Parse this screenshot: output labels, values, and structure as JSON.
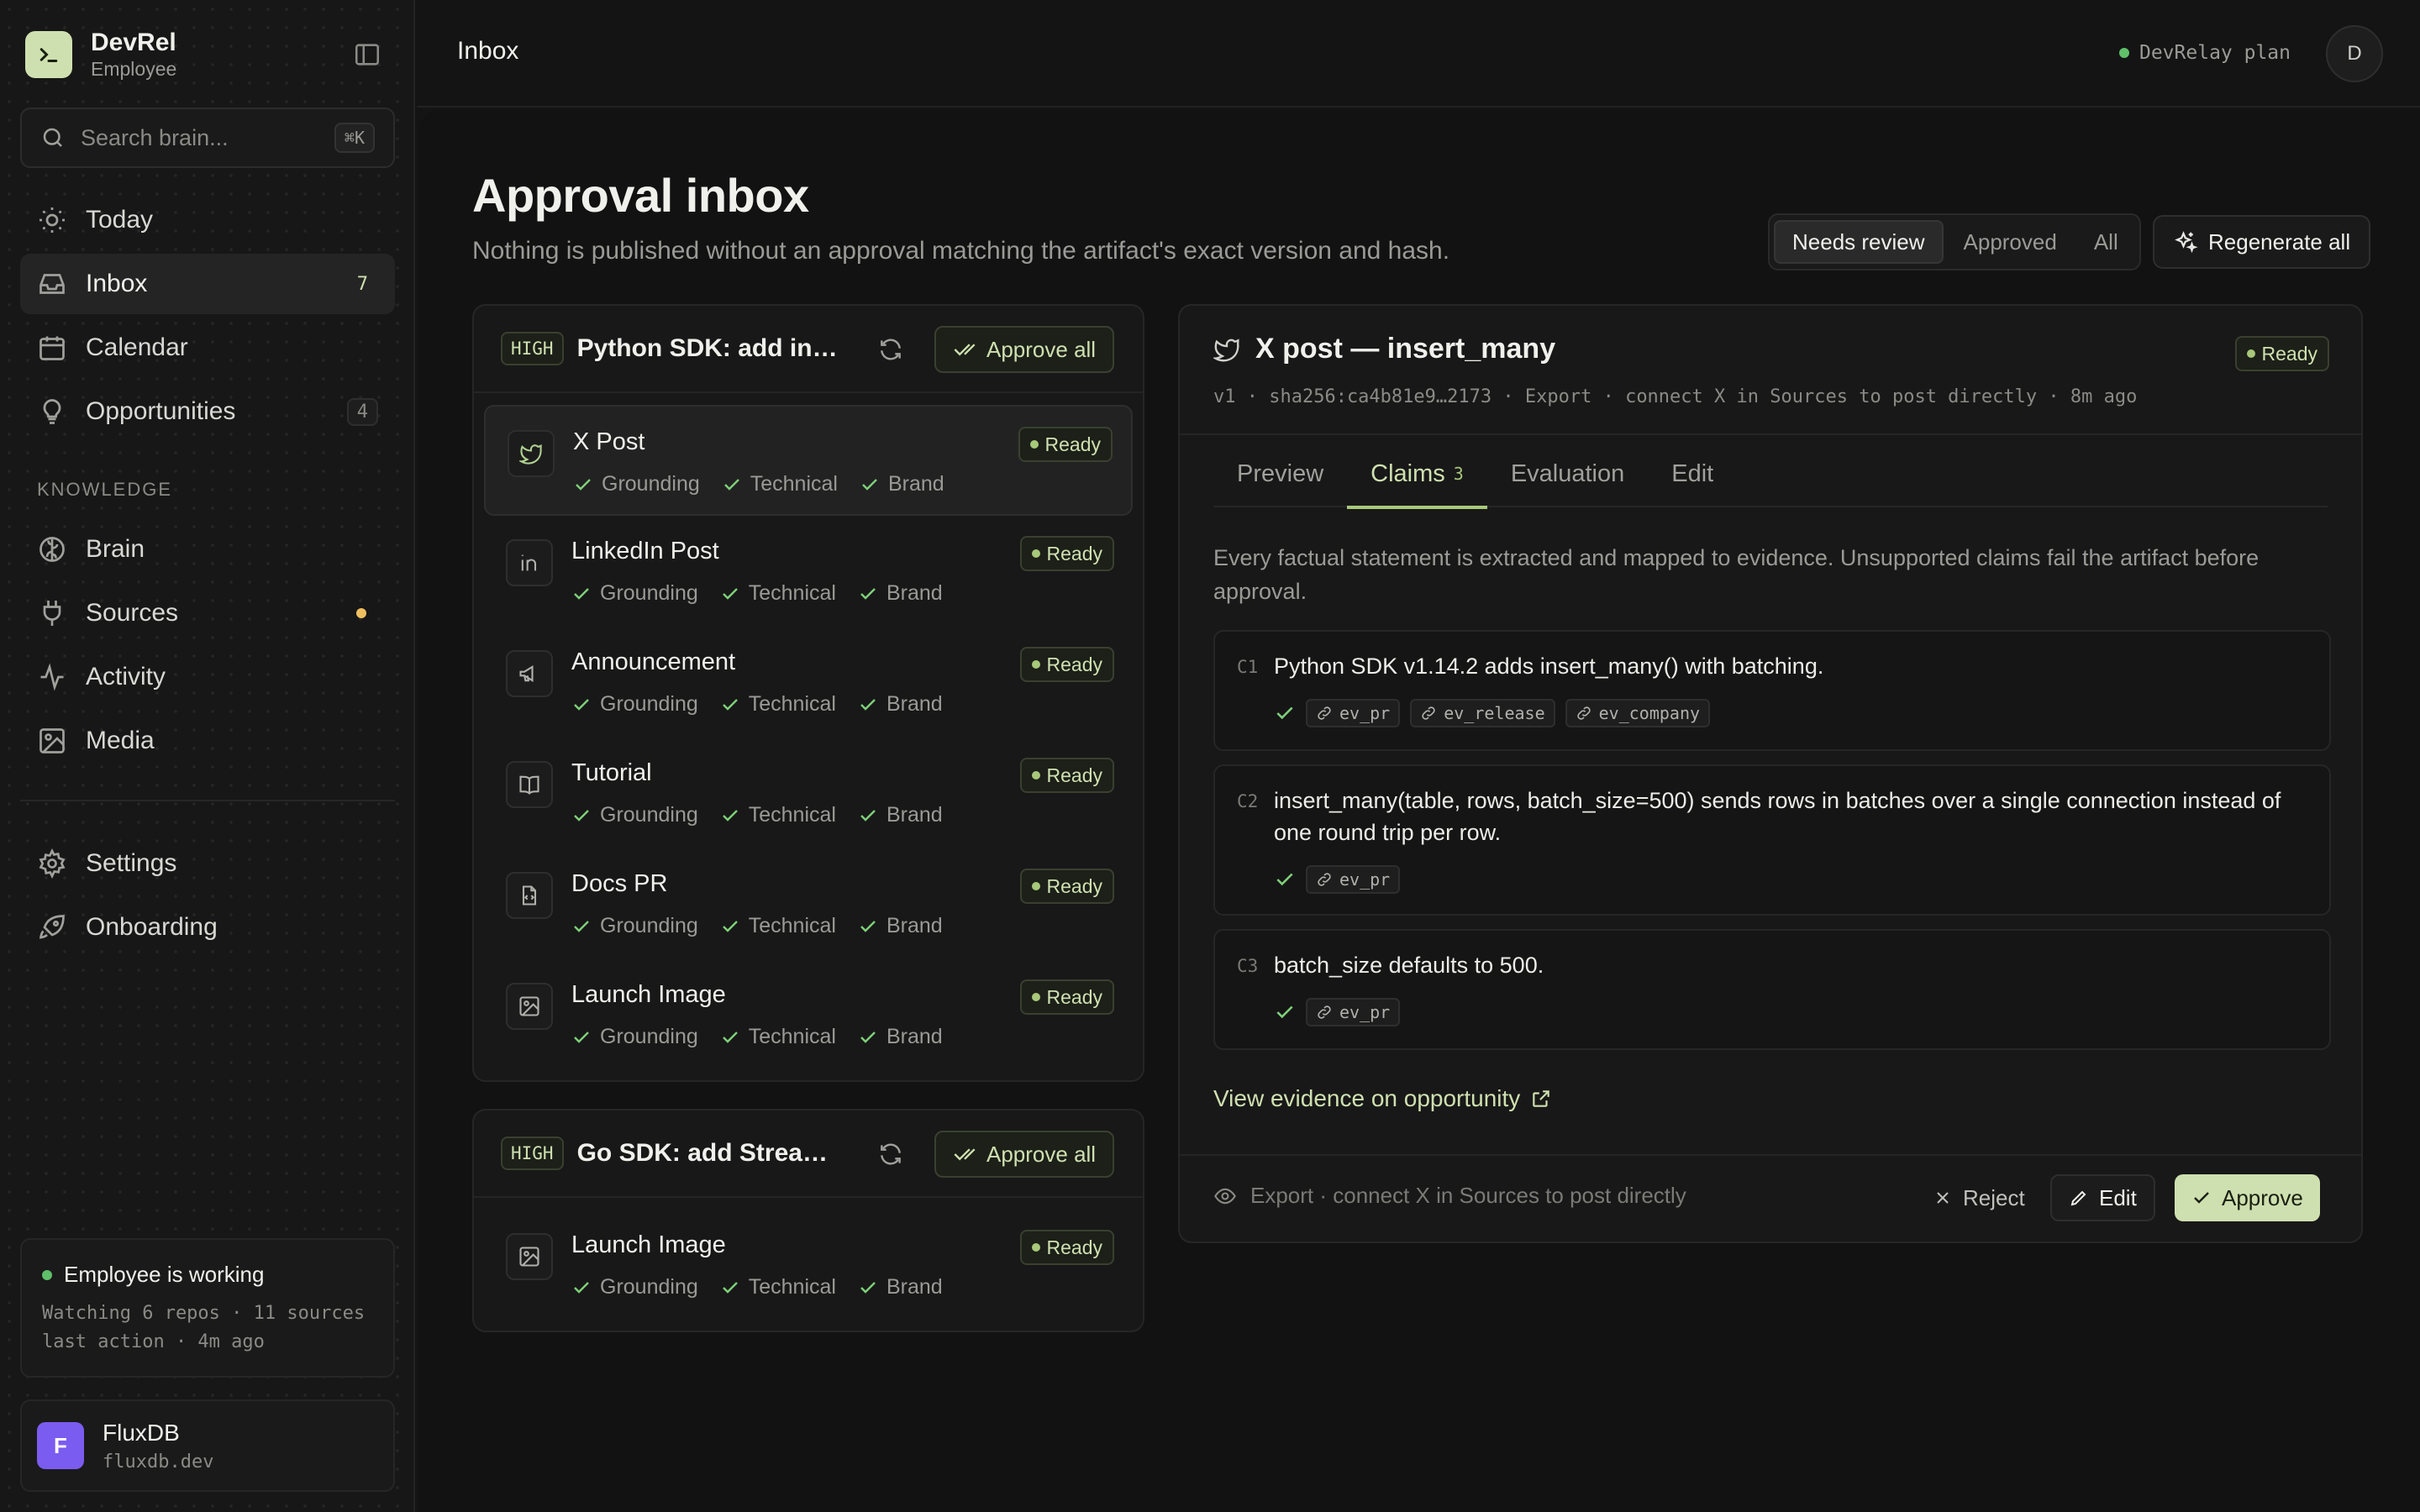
{
  "brand": {
    "name": "DevRel",
    "subtitle": "Employee"
  },
  "search": {
    "placeholder": "Search brain...",
    "shortcut": "⌘K"
  },
  "nav": {
    "today": "Today",
    "inbox": "Inbox",
    "inbox_count": "7",
    "calendar": "Calendar",
    "opportunities": "Opportunities",
    "opportunities_count": "4",
    "knowledge_label": "KNOWLEDGE",
    "brain": "Brain",
    "sources": "Sources",
    "activity": "Activity",
    "media": "Media",
    "settings": "Settings",
    "onboarding": "Onboarding"
  },
  "status": {
    "title": "Employee is working",
    "line1": "Watching 6 repos · 11 sources",
    "line2": "last action · 4m ago"
  },
  "org": {
    "initial": "F",
    "name": "FluxDB",
    "domain": "fluxdb.dev"
  },
  "topbar": {
    "crumb": "Inbox",
    "plan": "DevRelay plan",
    "avatar": "D"
  },
  "page": {
    "title": "Approval inbox",
    "subtitle": "Nothing is published without an approval matching the artifact's exact version and hash.",
    "filters": [
      "Needs review",
      "Approved",
      "All"
    ],
    "regenerate": "Regenerate all"
  },
  "groups": [
    {
      "priority": "HIGH",
      "title": "Python SDK: add ins...",
      "approve_all": "Approve all",
      "items": [
        {
          "title": "X Post",
          "status": "Ready",
          "checks": [
            "Grounding",
            "Technical",
            "Brand"
          ]
        },
        {
          "title": "LinkedIn Post",
          "status": "Ready",
          "checks": [
            "Grounding",
            "Technical",
            "Brand"
          ]
        },
        {
          "title": "Announcement",
          "status": "Ready",
          "checks": [
            "Grounding",
            "Technical",
            "Brand"
          ]
        },
        {
          "title": "Tutorial",
          "status": "Ready",
          "checks": [
            "Grounding",
            "Technical",
            "Brand"
          ]
        },
        {
          "title": "Docs PR",
          "status": "Ready",
          "checks": [
            "Grounding",
            "Technical",
            "Brand"
          ]
        },
        {
          "title": "Launch Image",
          "status": "Ready",
          "checks": [
            "Grounding",
            "Technical",
            "Brand"
          ]
        }
      ]
    },
    {
      "priority": "HIGH",
      "title": "Go SDK: add Stream(...",
      "approve_all": "Approve all",
      "items": [
        {
          "title": "Launch Image",
          "status": "Ready",
          "checks": [
            "Grounding",
            "Technical",
            "Brand"
          ]
        }
      ]
    }
  ],
  "detail": {
    "title": "X post — insert_many",
    "status": "Ready",
    "meta": "v1 · sha256:ca4b81e9…2173 · Export · connect X in Sources to post directly · 8m ago",
    "tabs": [
      "Preview",
      "Claims",
      "Evaluation",
      "Edit"
    ],
    "claims_count": "3",
    "description": "Every factual statement is extracted and mapped to evidence. Unsupported claims fail the artifact before approval.",
    "claims": [
      {
        "id": "C1",
        "text": "Python SDK v1.14.2 adds insert_many() with batching.",
        "evidence": [
          "ev_pr",
          "ev_release",
          "ev_company"
        ]
      },
      {
        "id": "C2",
        "text": "insert_many(table, rows, batch_size=500) sends rows in batches over a single connection instead of one round trip per row.",
        "evidence": [
          "ev_pr"
        ]
      },
      {
        "id": "C3",
        "text": "batch_size defaults to 500.",
        "evidence": [
          "ev_pr"
        ]
      }
    ],
    "view_evidence": "View evidence on opportunity",
    "footer_note": "Export · connect X in Sources to post directly",
    "reject": "Reject",
    "edit": "Edit",
    "approve": "Approve"
  },
  "colors": {
    "accent": "#cfe0b0",
    "accent_strong": "#a8c87a",
    "ok": "#5fc06a",
    "warn": "#f0c060",
    "org": "#7b5cf0"
  }
}
